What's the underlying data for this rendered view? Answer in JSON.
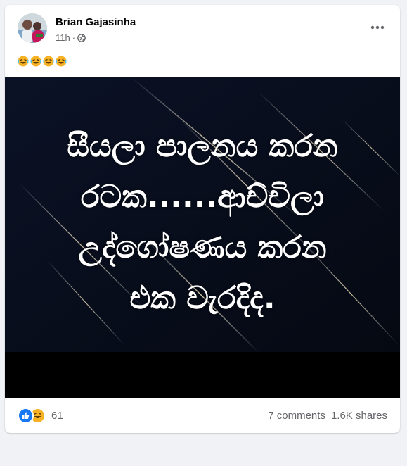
{
  "post": {
    "author": "Brian Gajasinha",
    "time": "11h",
    "time_separator": "·",
    "more_label": "•••",
    "caption_emojis": [
      "rofl-emoji",
      "rofl-emoji",
      "rofl-emoji",
      "rofl-emoji"
    ],
    "image_text_lines": [
      "සීයලා පාලනය කරන",
      "රටක......ආච්චිලා",
      "උද්ගෝෂණය කරන",
      "එක වැරදිද."
    ]
  },
  "footer": {
    "reaction_icons": [
      "like-icon",
      "haha-icon"
    ],
    "reaction_count": "61",
    "comments": "7 comments",
    "shares": "1.6K shares"
  },
  "colors": {
    "like": "#1877f2",
    "haha": "#f7b125",
    "meta_text": "#65676b",
    "image_bg": "#050912"
  }
}
